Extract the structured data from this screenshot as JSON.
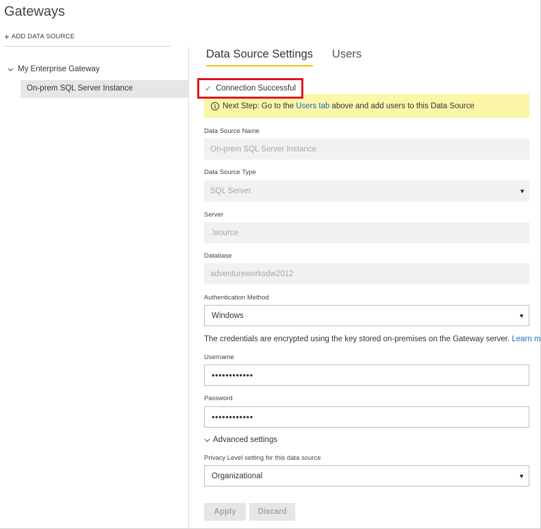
{
  "page": {
    "title": "Gateways"
  },
  "left": {
    "add_data_source": "ADD DATA SOURCE",
    "gateway": "My Enterprise Gateway",
    "selected_item": "On-prem SQL Server Instance"
  },
  "tabs": [
    {
      "label": "Data Source Settings",
      "active": true
    },
    {
      "label": "Users",
      "active": false
    }
  ],
  "status": {
    "message": "Connection Successful"
  },
  "notice": {
    "info_glyph": "i",
    "prefix": "Next Step: Go to the",
    "link": "Users tab",
    "suffix": "above and add users to this Data Source"
  },
  "form": {
    "name_label": "Data Source Name",
    "name_value": "On-prem SQL Server Instance",
    "type_label": "Data Source Type",
    "type_value": "SQL Server",
    "server_label": "Server",
    "server_value": ".\\source",
    "database_label": "Database",
    "database_value": "adventureworksdw2012",
    "auth_label": "Authentication Method",
    "auth_value": "Windows",
    "credentials_text": "The credentials are encrypted using the key stored on-premises on the Gateway server.",
    "learn_more": "Learn more",
    "username_label": "Username",
    "username_value": "••••••••••••",
    "password_label": "Password",
    "password_value": "••••••••••••",
    "advanced_label": "Advanced settings",
    "privacy_label": "Privacy Level setting for this data source",
    "privacy_value": "Organizational"
  },
  "buttons": {
    "apply": "Apply",
    "discard": "Discard"
  },
  "colors": {
    "accent_tab": "#f2c811",
    "highlight_box": "#e0141e",
    "notice_bg": "#fbf6a8",
    "link": "#1a6bbf",
    "success_check": "#4a9a4a"
  }
}
